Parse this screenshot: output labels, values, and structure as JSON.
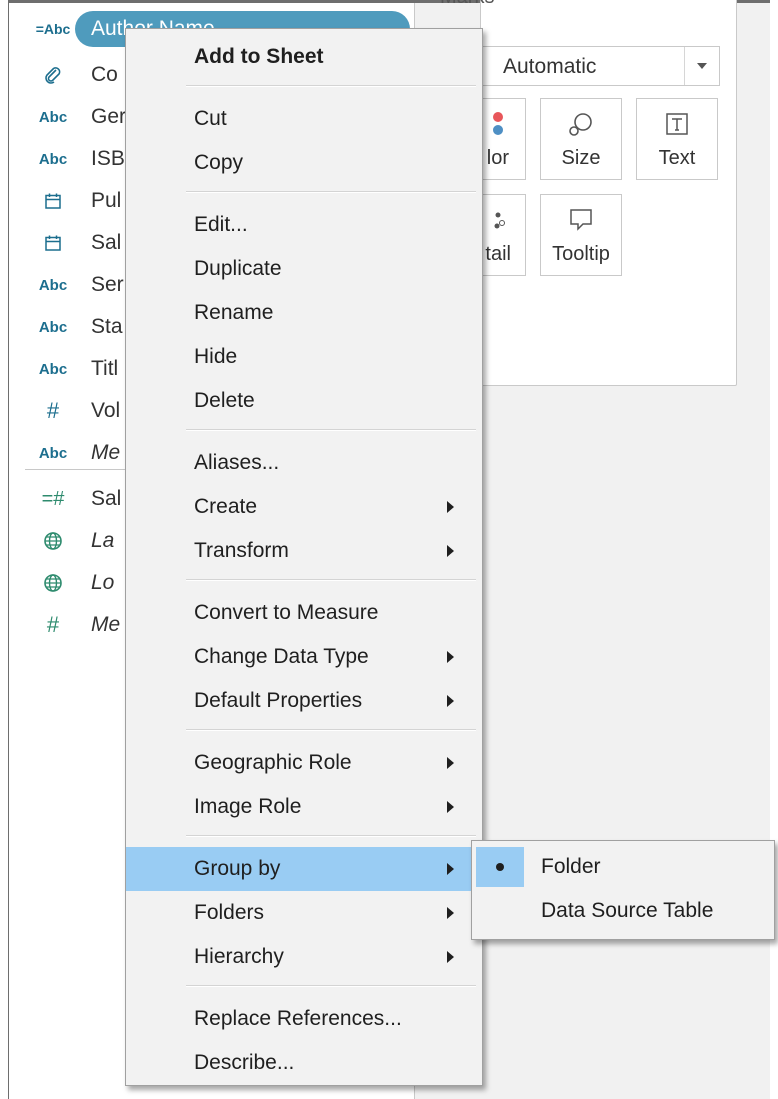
{
  "data_pane": {
    "selected_field": {
      "icon": "=Abc",
      "label": "Author Name"
    },
    "fields": [
      {
        "icon": "paperclip-icon",
        "label": "Co"
      },
      {
        "icon": "Abc",
        "label": "Ger"
      },
      {
        "icon": "Abc",
        "label": "ISB"
      },
      {
        "icon": "calendar-icon",
        "label": "Pul"
      },
      {
        "icon": "calendar-icon",
        "label": "Sal"
      },
      {
        "icon": "Abc",
        "label": "Ser"
      },
      {
        "icon": "Abc",
        "label": "Sta"
      },
      {
        "icon": "Abc",
        "label": "Titl"
      },
      {
        "icon": "#",
        "label": "Vol"
      },
      {
        "icon": "Abc",
        "label": "Me"
      },
      {
        "icon": "=#",
        "label": "Sal"
      },
      {
        "icon": "globe-icon",
        "label": "La"
      },
      {
        "icon": "globe-icon",
        "label": "Lo"
      },
      {
        "icon": "#",
        "label": "Me"
      }
    ]
  },
  "marks_card": {
    "title": "Marks",
    "mark_type": "Automatic",
    "buttons": [
      "lor",
      "Size",
      "Text",
      "tail",
      "Tooltip"
    ]
  },
  "context_menu": {
    "items": [
      {
        "label": "Add to Sheet",
        "bold": true
      },
      {
        "label": "Cut"
      },
      {
        "label": "Copy"
      },
      {
        "label": "Edit..."
      },
      {
        "label": "Duplicate"
      },
      {
        "label": "Rename"
      },
      {
        "label": "Hide"
      },
      {
        "label": "Delete"
      },
      {
        "label": "Aliases..."
      },
      {
        "label": "Create"
      },
      {
        "label": "Transform"
      },
      {
        "label": "Convert to Measure"
      },
      {
        "label": "Change Data Type"
      },
      {
        "label": "Default Properties"
      },
      {
        "label": "Geographic Role"
      },
      {
        "label": "Image Role"
      },
      {
        "label": "Group by",
        "highlighted": true
      },
      {
        "label": "Folders"
      },
      {
        "label": "Hierarchy"
      },
      {
        "label": "Replace References..."
      },
      {
        "label": "Describe..."
      }
    ]
  },
  "submenu": {
    "items": [
      {
        "label": "Folder",
        "checked": true
      },
      {
        "label": "Data Source Table"
      }
    ]
  },
  "colors": {
    "selection_pill": "#4f9bbd",
    "menu_highlight": "#99ccf3",
    "dimension_icon": "#1c6e8e",
    "measure_icon": "#2e8b6e"
  }
}
